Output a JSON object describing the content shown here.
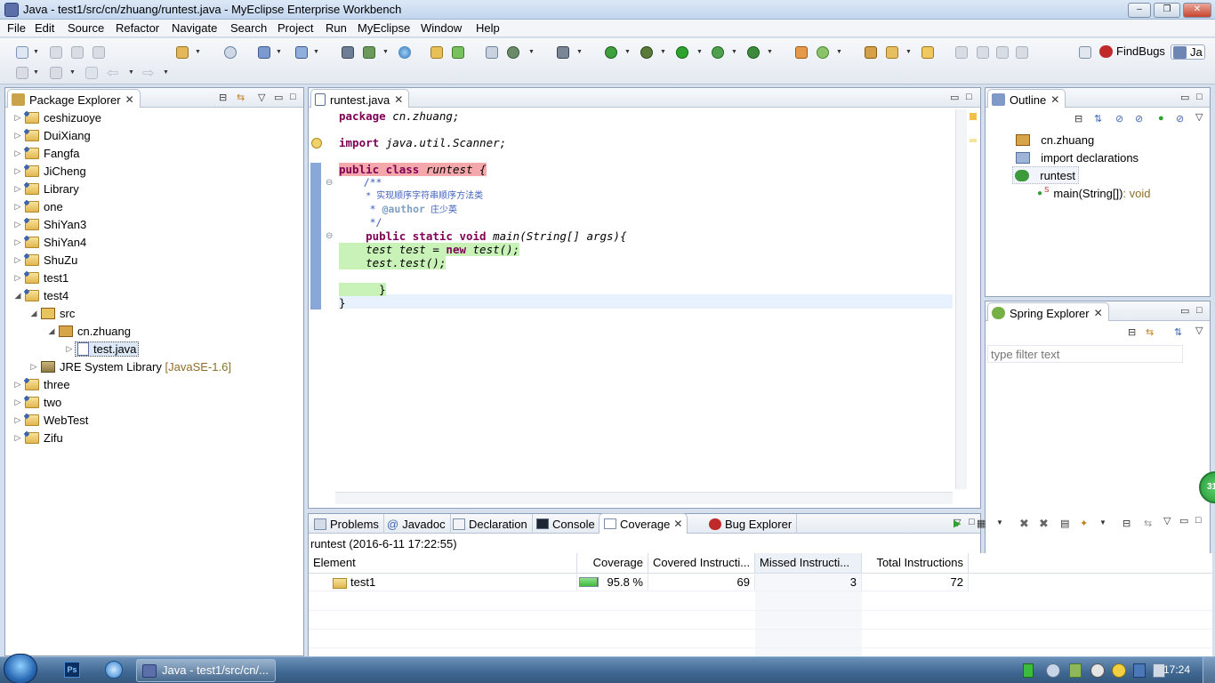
{
  "window": {
    "title": "Java - test1/src/cn/zhuang/runtest.java - MyEclipse Enterprise Workbench"
  },
  "menu": [
    "File",
    "Edit",
    "Source",
    "Refactor",
    "Navigate",
    "Search",
    "Project",
    "Run",
    "MyEclipse",
    "Window",
    "Help"
  ],
  "perspectives": {
    "findbugs": "FindBugs",
    "java": "Ja"
  },
  "package_explorer": {
    "title": "Package Explorer",
    "items": [
      {
        "label": "ceshizuoye",
        "type": "project",
        "expanded": false
      },
      {
        "label": "DuiXiang",
        "type": "project",
        "expanded": false
      },
      {
        "label": "Fangfa",
        "type": "project",
        "expanded": false
      },
      {
        "label": "JiCheng",
        "type": "project",
        "expanded": false
      },
      {
        "label": "Library",
        "type": "project",
        "expanded": false
      },
      {
        "label": "one",
        "type": "project",
        "expanded": false
      },
      {
        "label": "ShiYan3",
        "type": "project",
        "expanded": false
      },
      {
        "label": "ShiYan4",
        "type": "project",
        "expanded": false
      },
      {
        "label": "ShuZu",
        "type": "project",
        "expanded": false
      },
      {
        "label": "test1",
        "type": "project",
        "expanded": false
      },
      {
        "label": "test4",
        "type": "project",
        "expanded": true
      },
      {
        "label": "src",
        "type": "folder",
        "expanded": true
      },
      {
        "label": "cn.zhuang",
        "type": "package",
        "expanded": true
      },
      {
        "label": "test.java",
        "type": "file",
        "selected": true
      },
      {
        "label": "JRE System Library",
        "suffix": "[JavaSE-1.6]",
        "type": "library"
      },
      {
        "label": "three",
        "type": "project",
        "expanded": false
      },
      {
        "label": "two",
        "type": "project",
        "expanded": false
      },
      {
        "label": "WebTest",
        "type": "project",
        "expanded": false
      },
      {
        "label": "Zifu",
        "type": "project",
        "expanded": false
      }
    ]
  },
  "editor": {
    "tab": "runtest.java",
    "lines": {
      "l1a": "package ",
      "l1b": "cn.zhuang;",
      "l2a": "import ",
      "l2b": "java.util.Scanner;",
      "l3a": "public class ",
      "l3b": "runtest {",
      "l4": "    /**",
      "l5": "     * 实现顺序字符串顺序方法类",
      "l6a": "     * ",
      "l6b": "@author",
      "l6c": " 庄少英",
      "l7": "     */",
      "l8a": "    public static void ",
      "l8b": "main(String[] args){",
      "l9a": "    test test = ",
      "l9b": "new",
      "l9c": " test();",
      "l10": "    test.test();",
      "l11": "      }",
      "l12": "}"
    }
  },
  "outline": {
    "title": "Outline",
    "items": [
      "cn.zhuang",
      "import declarations",
      "runtest",
      "main(String[])"
    ],
    "return_type": " : void"
  },
  "spring_explorer": {
    "title": "Spring Explorer",
    "filter_placeholder": "type filter text"
  },
  "bottom_panel": {
    "tabs": [
      "Problems",
      "Javadoc",
      "Declaration",
      "Console",
      "Coverage",
      "Bug Explorer"
    ],
    "active_tab": "Coverage",
    "session": "runtest (2016-6-11 17:22:55)",
    "columns": [
      "Element",
      "Coverage",
      "Covered Instructi...",
      "Missed Instructi...",
      "Total Instructions"
    ],
    "rows": [
      {
        "element": "test1",
        "coverage": "95.8 %",
        "coverage_fraction": 0.958,
        "covered": "69",
        "missed": "3",
        "total": "72"
      }
    ]
  },
  "taskbar": {
    "active_task": "Java - test1/src/cn/...",
    "clock": "17:24",
    "badge": "31"
  },
  "colors": {
    "accent": "#3d64b0",
    "coverage_green": "#3cbc3c",
    "missed_red": "#f5a8ab",
    "covered_green": "#c9f2b8"
  }
}
